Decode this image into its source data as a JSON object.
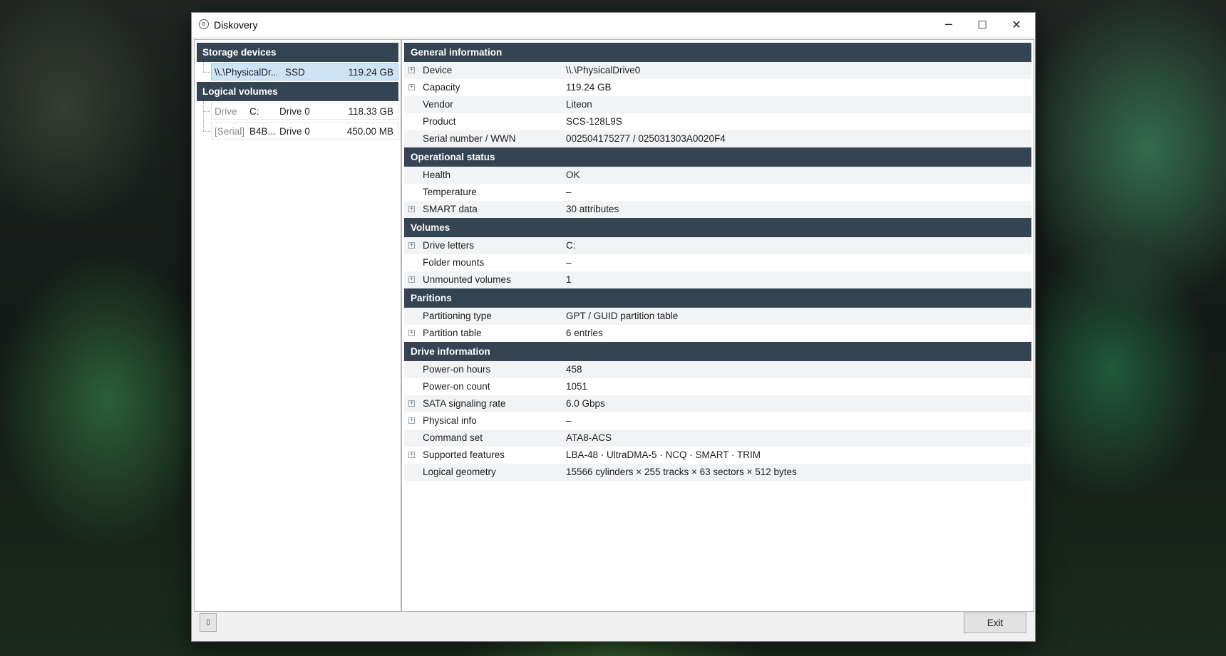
{
  "window": {
    "title": "Diskovery",
    "minimize_glyph": "─",
    "maximize_glyph": "☐",
    "close_glyph": "✕"
  },
  "left_pane": {
    "storage_devices": {
      "heading": "Storage devices",
      "items": [
        {
          "name": "\\\\.\\PhysicalDr...",
          "type": "SSD",
          "size": "119.24 GB",
          "selected": true
        }
      ]
    },
    "logical_volumes": {
      "heading": "Logical volumes",
      "items": [
        {
          "kind": "Drive",
          "id": "C:",
          "drive": "Drive 0",
          "size": "118.33 GB"
        },
        {
          "kind": "[Serial]",
          "id": "B4B...",
          "drive": "Drive 0",
          "size": "450.00 MB"
        }
      ]
    }
  },
  "sections": [
    {
      "heading": "General information",
      "rows": [
        {
          "label": "Device",
          "value": "\\\\.\\PhysicalDrive0",
          "expandable": true
        },
        {
          "label": "Capacity",
          "value": "119.24 GB",
          "expandable": true
        },
        {
          "label": "Vendor",
          "value": "Liteon",
          "expandable": false
        },
        {
          "label": "Product",
          "value": "SCS-128L9S",
          "expandable": false
        },
        {
          "label": "Serial number / WWN",
          "value": "002504175277 / 025031303A0020F4",
          "expandable": false
        }
      ]
    },
    {
      "heading": "Operational status",
      "rows": [
        {
          "label": "Health",
          "value": "OK",
          "expandable": false
        },
        {
          "label": "Temperature",
          "value": "–",
          "expandable": false
        },
        {
          "label": "SMART data",
          "value": "30 attributes",
          "expandable": true
        }
      ]
    },
    {
      "heading": "Volumes",
      "rows": [
        {
          "label": "Drive letters",
          "value": "C:",
          "expandable": true
        },
        {
          "label": "Folder mounts",
          "value": "–",
          "expandable": false
        },
        {
          "label": "Unmounted volumes",
          "value": "1",
          "expandable": true
        }
      ]
    },
    {
      "heading": "Paritions",
      "rows": [
        {
          "label": "Partitioning type",
          "value": "GPT / GUID partition table",
          "expandable": false
        },
        {
          "label": "Partition table",
          "value": "6 entries",
          "expandable": true
        }
      ]
    },
    {
      "heading": "Drive information",
      "rows": [
        {
          "label": "Power-on hours",
          "value": "458",
          "expandable": false
        },
        {
          "label": "Power-on count",
          "value": "1051",
          "expandable": false
        },
        {
          "label": "SATA signaling rate",
          "value": "6.0 Gbps",
          "expandable": true
        },
        {
          "label": "Physical info",
          "value": "–",
          "expandable": true
        },
        {
          "label": "Command set",
          "value": "ATA8-ACS",
          "expandable": false
        },
        {
          "label": "Supported features",
          "value": "LBA-48 · UltraDMA-5 · NCQ · SMART · TRIM",
          "expandable": true
        },
        {
          "label": "Logical geometry",
          "value": "15566 cylinders × 255 tracks × 63 sectors × 512 bytes",
          "expandable": false
        }
      ]
    }
  ],
  "footer": {
    "small_button_glyph": "▯",
    "exit_label": "Exit"
  },
  "icons": {
    "app": "app-disk-icon",
    "expander": "plus-box-icon"
  }
}
